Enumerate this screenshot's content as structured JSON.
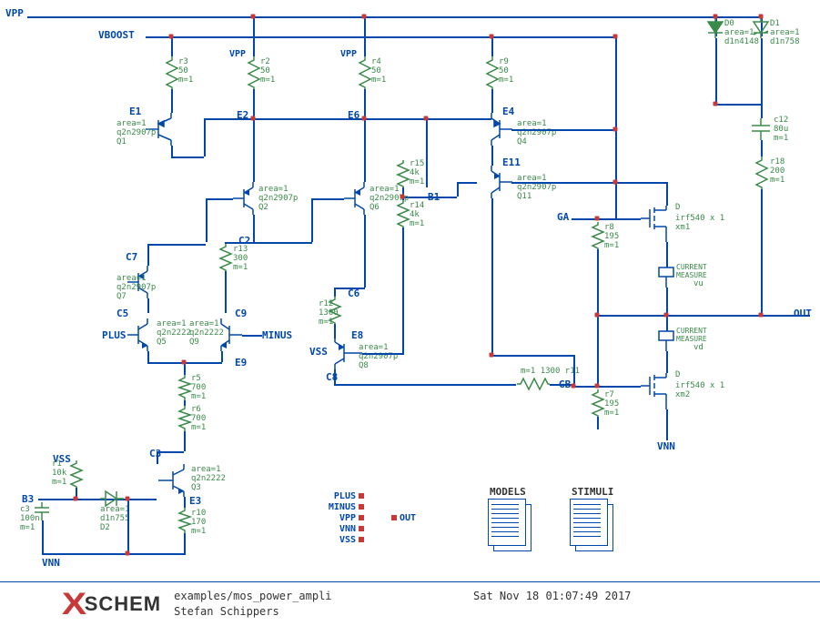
{
  "nets": {
    "vpp": "VPP",
    "vboost": "VBOOST",
    "vnn": "VNN",
    "vss": "VSS",
    "plus": "PLUS",
    "minus": "MINUS",
    "out": "OUT",
    "ga": "GA",
    "gb": "GB",
    "e1": "E1",
    "e2": "E2",
    "e3": "E3",
    "e4": "E4",
    "e6": "E6",
    "e8": "E8",
    "e9": "E9",
    "e11": "E11",
    "c2": "C2",
    "c3": "C3",
    "c5": "C5",
    "c6": "C6",
    "c7": "C7",
    "c8": "C8",
    "c9": "C9",
    "b1": "B1",
    "b3": "B3"
  },
  "components": {
    "d0": {
      "name": "D0",
      "model": "d1n4148",
      "param": "area=1"
    },
    "d1": {
      "name": "D1",
      "model": "d1n758",
      "param": "area=1"
    },
    "d2": {
      "name": "D2",
      "model": "d1n755",
      "param": "area=1"
    },
    "r1": {
      "name": "r1",
      "value": "10k",
      "m": "m=1"
    },
    "r2": {
      "name": "r2",
      "value": "50",
      "m": "m=1"
    },
    "r3": {
      "name": "r3",
      "value": "50",
      "m": "m=1"
    },
    "r4": {
      "name": "r4",
      "value": "50",
      "m": "m=1"
    },
    "r5": {
      "name": "r5",
      "value": "700",
      "m": "m=1"
    },
    "r6": {
      "name": "r6",
      "value": "700",
      "m": "m=1"
    },
    "r7": {
      "name": "r7",
      "value": "195",
      "m": "m=1"
    },
    "r8": {
      "name": "r8",
      "value": "195",
      "m": "m=1"
    },
    "r9": {
      "name": "r9",
      "value": "50",
      "m": "m=1"
    },
    "r10": {
      "name": "r10",
      "value": "170",
      "m": "m=1"
    },
    "r11": {
      "name": "r11",
      "value": "1300",
      "m": "m=1"
    },
    "r12": {
      "name": "r12",
      "value": "1300",
      "m": "m=1"
    },
    "r13": {
      "name": "r13",
      "value": "300",
      "m": "m=1"
    },
    "r14": {
      "name": "r14",
      "value": "4k",
      "m": "m=1"
    },
    "r15": {
      "name": "r15",
      "value": "4k",
      "m": "m=1"
    },
    "r18": {
      "name": "r18",
      "value": "200",
      "m": "m=1"
    },
    "c3": {
      "name": "c3",
      "value": "100n",
      "m": "m=1"
    },
    "c12": {
      "name": "c12",
      "value": "80u",
      "m": "m=1"
    },
    "q1": {
      "name": "Q1",
      "model": "q2n2907p",
      "param": "area=1"
    },
    "q2": {
      "name": "Q2",
      "model": "q2n2907p",
      "param": "area=1"
    },
    "q3": {
      "name": "Q3",
      "model": "q2n2222",
      "param": "area=1"
    },
    "q4": {
      "name": "Q4",
      "model": "q2n2907p",
      "param": "area=1"
    },
    "q5": {
      "name": "Q5",
      "model": "q2n2222",
      "param": "area=1"
    },
    "q6": {
      "name": "Q6",
      "model": "q2n2907p",
      "param": "area=1"
    },
    "q7": {
      "name": "Q7",
      "model": "q2n2907p",
      "param": "area=1"
    },
    "q8": {
      "name": "Q8",
      "model": "q2n2907p",
      "param": "area=1"
    },
    "q9": {
      "name": "Q9",
      "model": "q2n2222",
      "param": "area=1"
    },
    "q11": {
      "name": "Q11",
      "model": "q2n2907p",
      "param": "area=1"
    },
    "xm1": {
      "name": "xm1",
      "model": "irf540 x 1",
      "pin": "D"
    },
    "xm2": {
      "name": "xm2",
      "model": "irf540 x 1",
      "pin": "D"
    },
    "cm1": {
      "label": "CURRENT\nMEASURE",
      "net": "vu"
    },
    "cm2": {
      "label": "CURRENT\nMEASURE",
      "net": "vd"
    }
  },
  "io_pins": {
    "list_in": [
      "PLUS",
      "MINUS",
      "VPP",
      "VNN",
      "VSS"
    ],
    "list_out": [
      "OUT"
    ]
  },
  "docs": {
    "models": "MODELS",
    "stimuli": "STIMULI"
  },
  "footer": {
    "logo": "SCHEM",
    "path": "examples/mos_power_ampli",
    "author": "Stefan Schippers",
    "date": "Sat Nov 18 01:07:49 2017"
  }
}
